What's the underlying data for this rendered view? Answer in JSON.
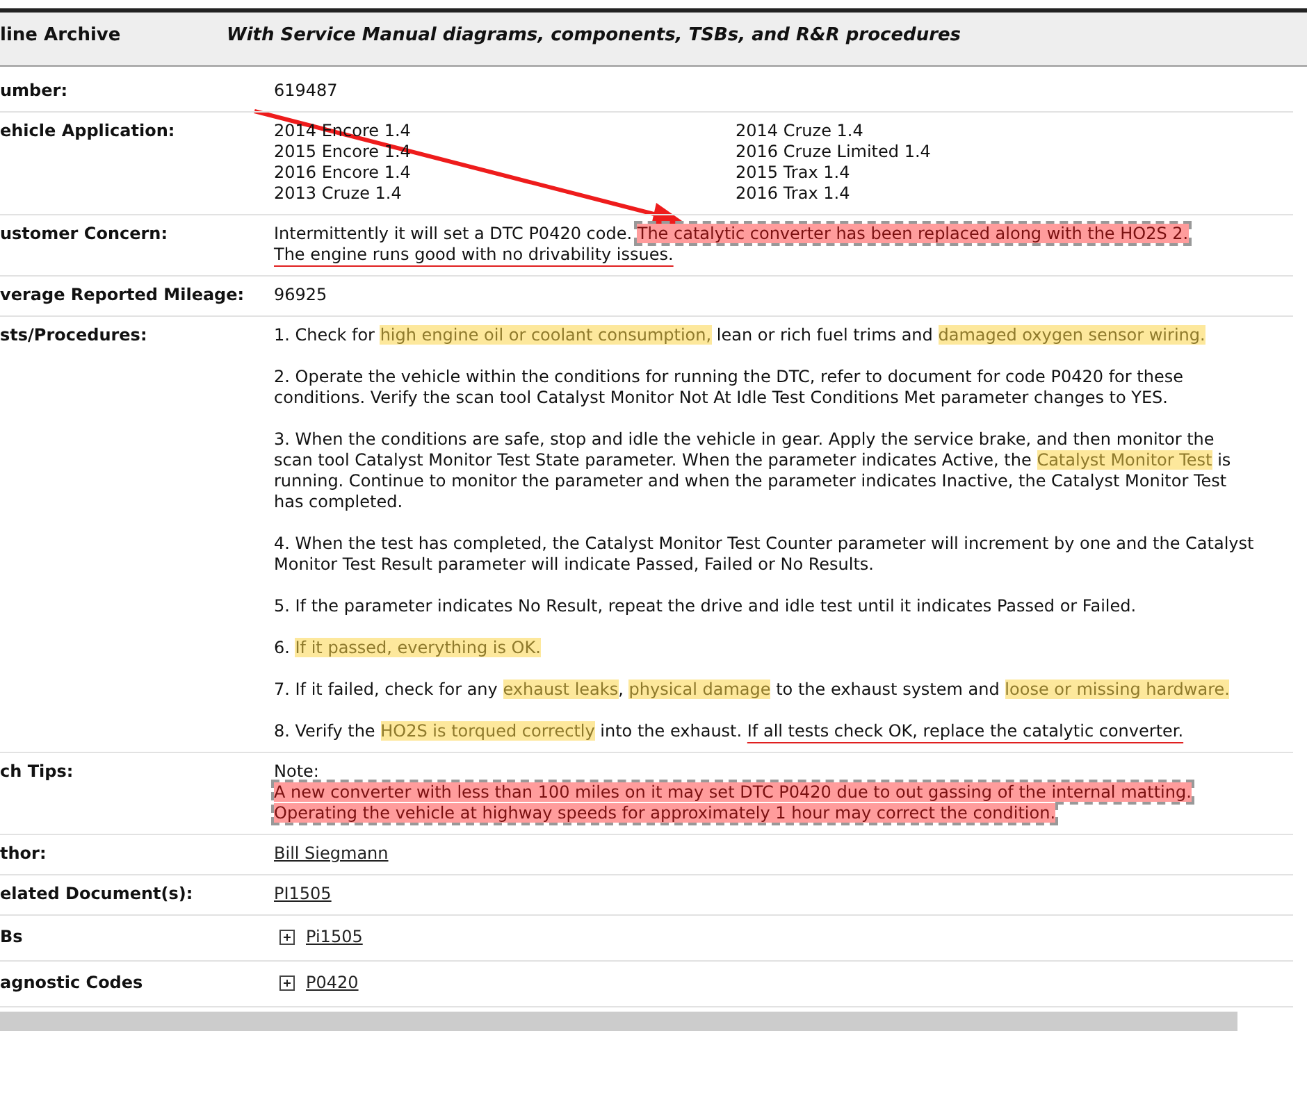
{
  "header": {
    "left": "line Archive",
    "right": "With Service Manual diagrams, components, TSBs, and R&R procedures"
  },
  "rows": [
    {
      "label": "umber:",
      "kind": "text",
      "value": "619487"
    },
    {
      "label": "ehicle Application:",
      "kind": "columns",
      "columns": [
        [
          "2014 Encore 1.4",
          "2015 Encore 1.4",
          "2016 Encore 1.4",
          "2013 Cruze 1.4"
        ],
        [
          "2014 Cruze 1.4",
          "2016 Cruze Limited 1.4",
          "2015 Trax 1.4",
          "2016 Trax 1.4"
        ]
      ]
    },
    {
      "label": "ustomer Concern:",
      "kind": "note",
      "paragraphs": [
        [
          {
            "text": "Intermittently it will set a DTC P0420 code. ",
            "kind": "plain"
          },
          {
            "text": "The catalytic converter has been replaced along with the HO2S 2.",
            "kind": "callout"
          }
        ],
        [
          {
            "text": "The engine runs good with no drivability issues.",
            "kind": "underline"
          }
        ]
      ]
    },
    {
      "label": "verage Reported Mileage:",
      "kind": "text",
      "value": "96925"
    },
    {
      "label": "sts/Procedures:",
      "kind": "steps",
      "paragraphs": [
        [
          {
            "text": "1. Check for ",
            "kind": "plain"
          },
          {
            "text": "high engine oil or coolant consumption,",
            "kind": "highlight"
          },
          {
            "text": " lean or rich fuel trims and ",
            "kind": "plain"
          },
          {
            "text": "damaged oxygen sensor wiring.",
            "kind": "highlight"
          }
        ],
        [
          {
            "text": "2. Operate the vehicle within the conditions for running the DTC, refer to document for code P0420 for these conditions. Verify the scan tool Catalyst Monitor Not At Idle Test Conditions Met parameter changes to YES.",
            "kind": "plain"
          }
        ],
        [
          {
            "text": "3. When the conditions are safe, stop and idle the vehicle in gear. Apply the service brake, and then monitor the scan tool Catalyst Monitor Test State parameter. When the parameter indicates Active, the ",
            "kind": "plain"
          },
          {
            "text": "Catalyst Monitor Test",
            "kind": "highlight"
          },
          {
            "text": " is running. Continue to monitor the parameter and when the parameter indicates Inactive, the Catalyst Monitor Test has completed.",
            "kind": "plain"
          }
        ],
        [
          {
            "text": "4. When the test has completed, the Catalyst Monitor Test Counter parameter will increment by one and the Catalyst Monitor Test Result parameter will indicate Passed, Failed or No Results.",
            "kind": "plain"
          }
        ],
        [
          {
            "text": "5. If the parameter indicates No Result, repeat the drive and idle test until it indicates Passed or Failed.",
            "kind": "plain"
          }
        ],
        [
          {
            "text": "6. ",
            "kind": "plain"
          },
          {
            "text": "If it passed, everything is OK.",
            "kind": "highlight"
          }
        ],
        [
          {
            "text": "7. If it failed, check for any ",
            "kind": "plain"
          },
          {
            "text": "exhaust leaks",
            "kind": "highlight"
          },
          {
            "text": ", ",
            "kind": "plain"
          },
          {
            "text": "physical damage",
            "kind": "highlight"
          },
          {
            "text": " to the exhaust system and ",
            "kind": "plain"
          },
          {
            "text": "loose or missing hardware.",
            "kind": "highlight"
          }
        ],
        [
          {
            "text": "8. Verify the ",
            "kind": "plain"
          },
          {
            "text": "HO2S is torqued correctly",
            "kind": "highlight"
          },
          {
            "text": " into the exhaust. ",
            "kind": "plain"
          },
          {
            "text": "If all tests check OK, replace the catalytic converter.",
            "kind": "underline"
          }
        ]
      ]
    },
    {
      "label": "ch Tips:",
      "kind": "note",
      "paragraphs": [
        [
          {
            "text": "Note:",
            "kind": "plain"
          }
        ],
        [
          {
            "text": "A new converter with less than 100 miles on it may set DTC P0420 due to out gassing of the internal matting. Operating the vehicle at highway speeds for approximately 1 hour may correct the condition.",
            "kind": "callout"
          }
        ]
      ]
    },
    {
      "label": "thor:",
      "kind": "link",
      "value": "Bill Siegmann"
    },
    {
      "label": "elated Document(s):",
      "kind": "link",
      "value": "PI1505"
    },
    {
      "label": "Bs",
      "kind": "expand",
      "value": "Pi1505"
    },
    {
      "label": "agnostic Codes",
      "kind": "expand",
      "value": "P0420"
    }
  ]
}
